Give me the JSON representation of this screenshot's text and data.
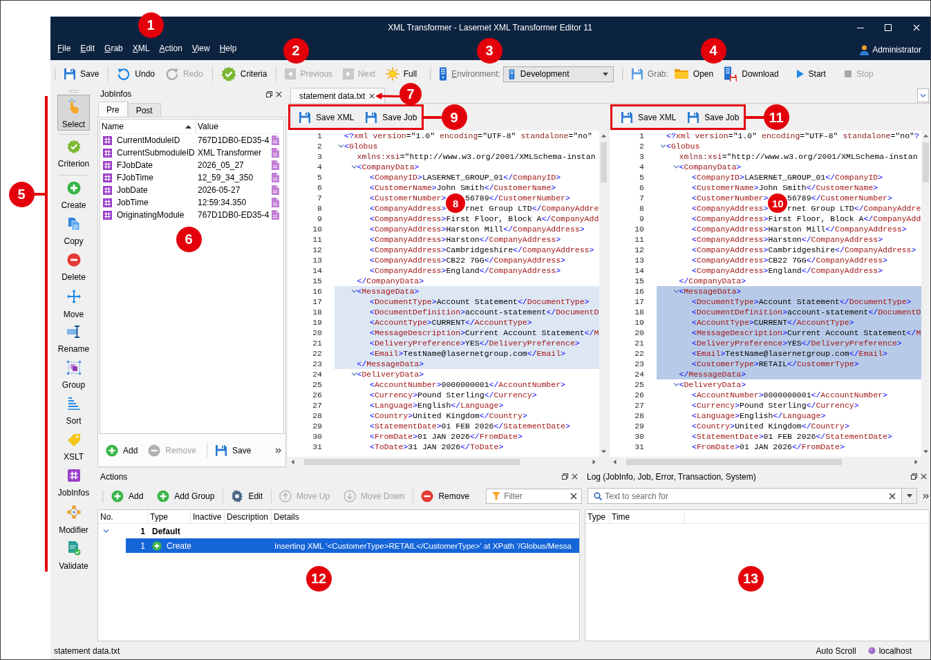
{
  "window": {
    "title": "XML Transformer - Lasernet XML Transformer Editor 11"
  },
  "menu": [
    {
      "label": "File"
    },
    {
      "label": "Edit"
    },
    {
      "label": "Grab"
    },
    {
      "label": "XML"
    },
    {
      "label": "Action"
    },
    {
      "label": "View"
    },
    {
      "label": "Help"
    }
  ],
  "user": {
    "name": "Administrator"
  },
  "toolbar": [
    {
      "kind": "button",
      "label": "Save",
      "disabled": false
    },
    {
      "kind": "button",
      "label": "Undo",
      "disabled": false
    },
    {
      "kind": "button",
      "label": "Redo",
      "disabled": true
    },
    {
      "kind": "button",
      "label": "Criteria",
      "disabled": false
    },
    {
      "kind": "button",
      "label": "Previous",
      "disabled": true
    },
    {
      "kind": "button",
      "label": "Next",
      "disabled": true
    },
    {
      "kind": "button",
      "label": "Full",
      "disabled": false
    },
    {
      "kind": "label",
      "label": "Environment:"
    },
    {
      "kind": "dropdown",
      "value": "Development"
    },
    {
      "kind": "label",
      "label": "Grab:"
    },
    {
      "kind": "button",
      "label": "Open",
      "disabled": false
    },
    {
      "kind": "button",
      "label": "Download",
      "disabled": false
    },
    {
      "kind": "button",
      "label": "Start",
      "disabled": false
    },
    {
      "kind": "button",
      "label": "Stop",
      "disabled": true
    }
  ],
  "tools": [
    {
      "label": "Select",
      "selected": true
    },
    {
      "label": "Criterion",
      "selected": false
    },
    {
      "label": "Create",
      "selected": false
    },
    {
      "label": "Copy",
      "selected": false
    },
    {
      "label": "Delete",
      "selected": false
    },
    {
      "label": "Move",
      "selected": false
    },
    {
      "label": "Rename",
      "selected": false
    },
    {
      "label": "Group",
      "selected": false
    },
    {
      "label": "Sort",
      "selected": false
    },
    {
      "label": "XSLT",
      "selected": false
    },
    {
      "label": "JobInfos",
      "selected": false
    },
    {
      "label": "Modifier",
      "selected": false
    },
    {
      "label": "Validate",
      "selected": false
    }
  ],
  "jobinfos": {
    "title": "JobInfos",
    "tabs": [
      {
        "label": "Pre",
        "selected": true
      },
      {
        "label": "Post",
        "selected": false
      }
    ],
    "columns": [
      {
        "label": "Name",
        "sorted": true
      },
      {
        "label": "Value",
        "sorted": false
      }
    ],
    "rows": [
      {
        "name": "CurrentModuleID",
        "value": "767D1DB0-ED35-4"
      },
      {
        "name": "CurrentSubmoduleID",
        "value": "XML Transformer"
      },
      {
        "name": "FJobDate",
        "value": "2026_05_27"
      },
      {
        "name": "FJobTime",
        "value": "12_59_34_350"
      },
      {
        "name": "JobDate",
        "value": "2026-05-27"
      },
      {
        "name": "JobTime",
        "value": "12:59:34.350"
      },
      {
        "name": "OriginatingModule",
        "value": "767D1DB0-ED35-4"
      }
    ],
    "buttons": [
      {
        "label": "Add",
        "disabled": false
      },
      {
        "label": "Remove",
        "disabled": true
      },
      {
        "label": "Save",
        "disabled": false
      }
    ]
  },
  "editor": {
    "tabs": [
      {
        "label": "statement data.txt",
        "selected": true
      }
    ],
    "panes": [
      {
        "active": false,
        "outlined": true,
        "buttons": [
          {
            "label": "Save XML"
          },
          {
            "label": "Save Job"
          }
        ],
        "lines": [
          {
            "number": "1",
            "text": "<?xml version=\"1.0\"  encoding=\"UTF-8\" standalone=\"no\"",
            "highlighted": false
          },
          {
            "number": "2",
            "text": "<Globus",
            "highlighted": false,
            "expanded": true,
            "children": [
              {
                "number": "3",
                "text": "xmlns:xsi=\"http://www.w3.org/2001/XMLSchema-instan",
                "highlighted": false
              },
              {
                "number": "4",
                "text": "<CompanyData>",
                "highlighted": false,
                "expanded": true,
                "children": [
                  {
                    "number": "5",
                    "text": "<CompanyID>LASERNET_GROUP_01</CompanyID>",
                    "highlighted": false
                  },
                  {
                    "number": "6",
                    "text": "<CustomerName>John Smith</CustomerName>",
                    "highlighted": false
                  },
                  {
                    "number": "7",
                    "text": "<CustomerNumber>",
                    "text_after": "56789</CustomerNumber>",
                    "highlighted": false
                  },
                  {
                    "number": "8",
                    "text": "<CompanyAddress>",
                    "text_after": "rnet Group LTD</CompanyAddre",
                    "highlighted": false
                  },
                  {
                    "number": "9",
                    "text": "<CompanyAddress>First Floor, Block A</CompanyAdd",
                    "highlighted": false
                  },
                  {
                    "number": "10",
                    "text": "<CompanyAddress>Harston Mill</CompanyAddress>",
                    "highlighted": false
                  },
                  {
                    "number": "11",
                    "text": "<CompanyAddress>Harston</CompanyAddress>",
                    "highlighted": false
                  },
                  {
                    "number": "12",
                    "text": "<CompanyAddress>Cambridgeshire</CompanyAddress>",
                    "highlighted": false
                  },
                  {
                    "number": "13",
                    "text": "<CompanyAddress>CB22 7GG</CompanyAddress>",
                    "highlighted": false
                  },
                  {
                    "number": "14",
                    "text": "<CompanyAddress>England</CompanyAddress>",
                    "highlighted": false
                  }
                ]
              },
              {
                "number": "15",
                "text": "</CompanyData>",
                "highlighted": false
              },
              {
                "number": "16",
                "text": "<MessageData>",
                "highlighted": true,
                "expanded": true,
                "children": [
                  {
                    "number": "17",
                    "text": "<DocumentType>Account Statement</DocumentType>",
                    "highlighted": true
                  },
                  {
                    "number": "18",
                    "text": "<DocumentDefinition>account-statement</DocumentD",
                    "highlighted": true
                  },
                  {
                    "number": "19",
                    "text": "<AccountType>CURRENT</AccountType>",
                    "highlighted": true
                  },
                  {
                    "number": "20",
                    "text": "<MessageDescription>Current Account Statement</M",
                    "highlighted": true
                  },
                  {
                    "number": "21",
                    "text": "<DeliveryPreference>YES</DeliveryPreference>",
                    "highlighted": true
                  },
                  {
                    "number": "22",
                    "text": "<Email>TestName@lasernetgroup.com</Email>",
                    "highlighted": true
                  }
                ]
              },
              {
                "number": "23",
                "text": "</MessageData>",
                "highlighted": true
              },
              {
                "number": "24",
                "text": "<DeliveryData>",
                "highlighted": false,
                "expanded": true,
                "children": [
                  {
                    "number": "25",
                    "text": "<AccountNumber>0000000001</AccountNumber>",
                    "highlighted": false
                  },
                  {
                    "number": "26",
                    "text": "<Currency>Pound Sterling</Currency>",
                    "highlighted": false
                  },
                  {
                    "number": "27",
                    "text": "<Language>English</Language>",
                    "highlighted": false
                  },
                  {
                    "number": "28",
                    "text": "<Country>United Kingdom</Country>",
                    "highlighted": false
                  },
                  {
                    "number": "29",
                    "text": "<StatementDate>01 FEB 2026</StatementDate>",
                    "highlighted": false
                  },
                  {
                    "number": "30",
                    "text": "<FromDate>01 JAN 2026</FromDate>",
                    "highlighted": false
                  },
                  {
                    "number": "31",
                    "text": "<ToDate>31 JAN 2026</ToDate>",
                    "highlighted": false
                  }
                ]
              }
            ]
          }
        ]
      },
      {
        "active": true,
        "outlined": true,
        "buttons": [
          {
            "label": "Save XML"
          },
          {
            "label": "Save Job"
          }
        ],
        "lines": [
          {
            "number": "1",
            "text": "<?xml version=\"1.0\" encoding=\"UTF-8\" standalone=\"no\"?",
            "highlighted": false
          },
          {
            "number": "2",
            "text": "<Globus",
            "highlighted": false,
            "expanded": true,
            "children": [
              {
                "number": "3",
                "text": "xmlns:xsi=\"http://www.w3.org/2001/XMLSchema-instan",
                "highlighted": false
              },
              {
                "number": "4",
                "text": "<CompanyData>",
                "highlighted": false,
                "expanded": true,
                "children": [
                  {
                    "number": "5",
                    "text": "<CompanyID>LASERNET_GROUP_01</CompanyID>",
                    "highlighted": false
                  },
                  {
                    "number": "6",
                    "text": "<CustomerName>John Smith</CustomerName>",
                    "highlighted": false
                  },
                  {
                    "number": "7",
                    "text": "<CustomerNumber>",
                    "text_after": "56789</CustomerNumber>",
                    "highlighted": false
                  },
                  {
                    "number": "8",
                    "text": "<CompanyAddress>",
                    "text_after": "rnet Group LTD</CompanyAddre",
                    "highlighted": false
                  },
                  {
                    "number": "9",
                    "text": "<CompanyAddress>First Floor, Block A</CompanyAdd",
                    "highlighted": false
                  },
                  {
                    "number": "10",
                    "text": "<CompanyAddress>Harston Mill</CompanyAddress>",
                    "highlighted": false
                  },
                  {
                    "number": "11",
                    "text": "<CompanyAddress>Harston</CompanyAddress>",
                    "highlighted": false
                  },
                  {
                    "number": "12",
                    "text": "<CompanyAddress>Cambridgeshire</CompanyAddress>",
                    "highlighted": false
                  },
                  {
                    "number": "13",
                    "text": "<CompanyAddress>CB22 7GG</CompanyAddress>",
                    "highlighted": false
                  },
                  {
                    "number": "14",
                    "text": "<CompanyAddress>England</CompanyAddress>",
                    "highlighted": false
                  }
                ]
              },
              {
                "number": "15",
                "text": "</CompanyData>",
                "highlighted": false
              },
              {
                "number": "16",
                "text": "<MessageData>",
                "highlighted": true,
                "expanded": true,
                "children": [
                  {
                    "number": "17",
                    "text": "<DocumentType>Account Statement</DocumentType>",
                    "highlighted": true
                  },
                  {
                    "number": "18",
                    "text": "<DocumentDefinition>account-statement</DocumentD",
                    "highlighted": true
                  },
                  {
                    "number": "19",
                    "text": "<AccountType>CURRENT</AccountType>",
                    "highlighted": true
                  },
                  {
                    "number": "20",
                    "text": "<MessageDescription>Current Account Statement</M",
                    "highlighted": true
                  },
                  {
                    "number": "21",
                    "text": "<DeliveryPreference>YES</DeliveryPreference>",
                    "highlighted": true
                  },
                  {
                    "number": "22",
                    "text": "<Email>TestName@lasernetgroup.com</Email>",
                    "highlighted": true
                  },
                  {
                    "number": "23",
                    "text": "<CustomerType>RETAIL</CustomerType>",
                    "highlighted": true
                  }
                ]
              },
              {
                "number": "24",
                "text": "</MessageData>",
                "highlighted": true
              },
              {
                "number": "25",
                "text": "<DeliveryData>",
                "highlighted": false,
                "expanded": true,
                "children": [
                  {
                    "number": "26",
                    "text": "<AccountNumber>0000000001</AccountNumber>",
                    "highlighted": false
                  },
                  {
                    "number": "27",
                    "text": "<Currency>Pound Sterling</Currency>",
                    "highlighted": false
                  },
                  {
                    "number": "28",
                    "text": "<Language>English</Language>",
                    "highlighted": false
                  },
                  {
                    "number": "29",
                    "text": "<Country>United Kingdom</Country>",
                    "highlighted": false
                  },
                  {
                    "number": "30",
                    "text": "<StatementDate>01 FEB 2026</StatementDate>",
                    "highlighted": false
                  },
                  {
                    "number": "31",
                    "text": "<FromDate>01 JAN 2026</FromDate>",
                    "highlighted": false
                  }
                ]
              }
            ]
          }
        ]
      }
    ]
  },
  "actions": {
    "title": "Actions",
    "buttons": [
      {
        "label": "Add",
        "disabled": false
      },
      {
        "label": "Add Group",
        "disabled": false
      },
      {
        "label": "Edit",
        "disabled": false
      },
      {
        "label": "Move Up",
        "disabled": true
      },
      {
        "label": "Move Down",
        "disabled": true
      },
      {
        "label": "Remove",
        "disabled": false
      }
    ],
    "filter": {
      "placeholder": "Filter"
    },
    "columns": [
      "No.",
      "Type",
      "Inactive",
      "Description",
      "Details"
    ],
    "rows": [
      {
        "kind": "group",
        "no": "1",
        "type": "Default",
        "expanded": true,
        "selected": false,
        "children": [
          {
            "kind": "action",
            "no": "1",
            "type": "Create",
            "details": "Inserting XML '<CustomerType>RETAIL</CustomerType>' at XPath '/Globus/Messa",
            "selected": true
          }
        ]
      }
    ]
  },
  "log": {
    "title": "Log (JobInfo, Job, Error, Transaction, System)",
    "search": {
      "placeholder": "Text to search for"
    },
    "columns": [
      "Type",
      "Time"
    ]
  },
  "status_bar": {
    "file": "statement data.txt",
    "auto_scroll": "Auto Scroll",
    "server": "localhost"
  },
  "callouts": [
    {
      "number": "1",
      "kind": "plain"
    },
    {
      "number": "2",
      "kind": "plain"
    },
    {
      "number": "3",
      "kind": "plain"
    },
    {
      "number": "4",
      "kind": "plain"
    },
    {
      "number": "5",
      "kind": "bracket"
    },
    {
      "number": "6",
      "kind": "plain"
    },
    {
      "number": "7",
      "kind": "arrow"
    },
    {
      "number": "8",
      "kind": "plain"
    },
    {
      "number": "9",
      "kind": "line"
    },
    {
      "number": "10",
      "kind": "plain"
    },
    {
      "number": "11",
      "kind": "line"
    },
    {
      "number": "12",
      "kind": "plain"
    },
    {
      "number": "13",
      "kind": "plain"
    }
  ]
}
